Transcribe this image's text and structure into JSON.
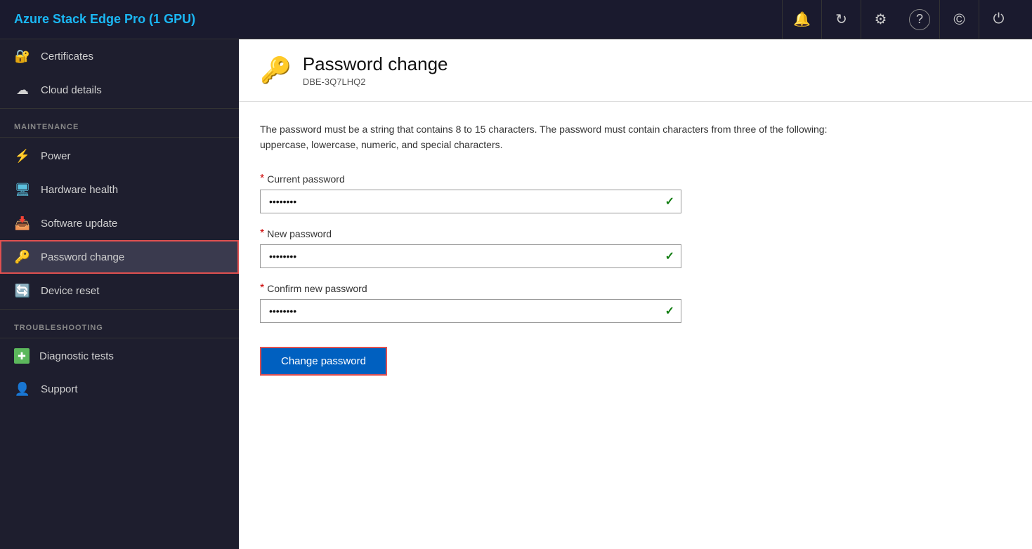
{
  "app": {
    "title": "Azure Stack Edge Pro (1 GPU)"
  },
  "topbar": {
    "icons": [
      {
        "name": "bell-icon",
        "symbol": "🔔"
      },
      {
        "name": "refresh-icon",
        "symbol": "↻"
      },
      {
        "name": "settings-icon",
        "symbol": "⚙"
      },
      {
        "name": "help-icon",
        "symbol": "?"
      },
      {
        "name": "copyright-icon",
        "symbol": "©"
      },
      {
        "name": "power-icon",
        "symbol": "⏻"
      }
    ]
  },
  "sidebar": {
    "items_top": [
      {
        "id": "certificates",
        "label": "Certificates",
        "icon": "🔐"
      },
      {
        "id": "cloud-details",
        "label": "Cloud details",
        "icon": "☁"
      }
    ],
    "maintenance_label": "MAINTENANCE",
    "items_maintenance": [
      {
        "id": "power",
        "label": "Power",
        "icon": "⚡"
      },
      {
        "id": "hardware-health",
        "label": "Hardware health",
        "icon": "🖥"
      },
      {
        "id": "software-update",
        "label": "Software update",
        "icon": "📥"
      },
      {
        "id": "password-change",
        "label": "Password change",
        "icon": "🔑",
        "active": true
      },
      {
        "id": "device-reset",
        "label": "Device reset",
        "icon": "🔄"
      }
    ],
    "troubleshooting_label": "TROUBLESHOOTING",
    "items_troubleshooting": [
      {
        "id": "diagnostic-tests",
        "label": "Diagnostic tests",
        "icon": "➕"
      },
      {
        "id": "support",
        "label": "Support",
        "icon": "👤"
      }
    ]
  },
  "page": {
    "icon": "🔑",
    "title": "Password change",
    "subtitle": "DBE-3Q7LHQ2",
    "description": "The password must be a string that contains 8 to 15 characters. The password must contain characters from three of the following: uppercase, lowercase, numeric, and special characters.",
    "form": {
      "current_password_label": "Current password",
      "current_password_value": "••••••••",
      "new_password_label": "New password",
      "new_password_value": "••••••••",
      "confirm_password_label": "Confirm new password",
      "confirm_password_value": "••••••••",
      "submit_label": "Change password"
    }
  }
}
